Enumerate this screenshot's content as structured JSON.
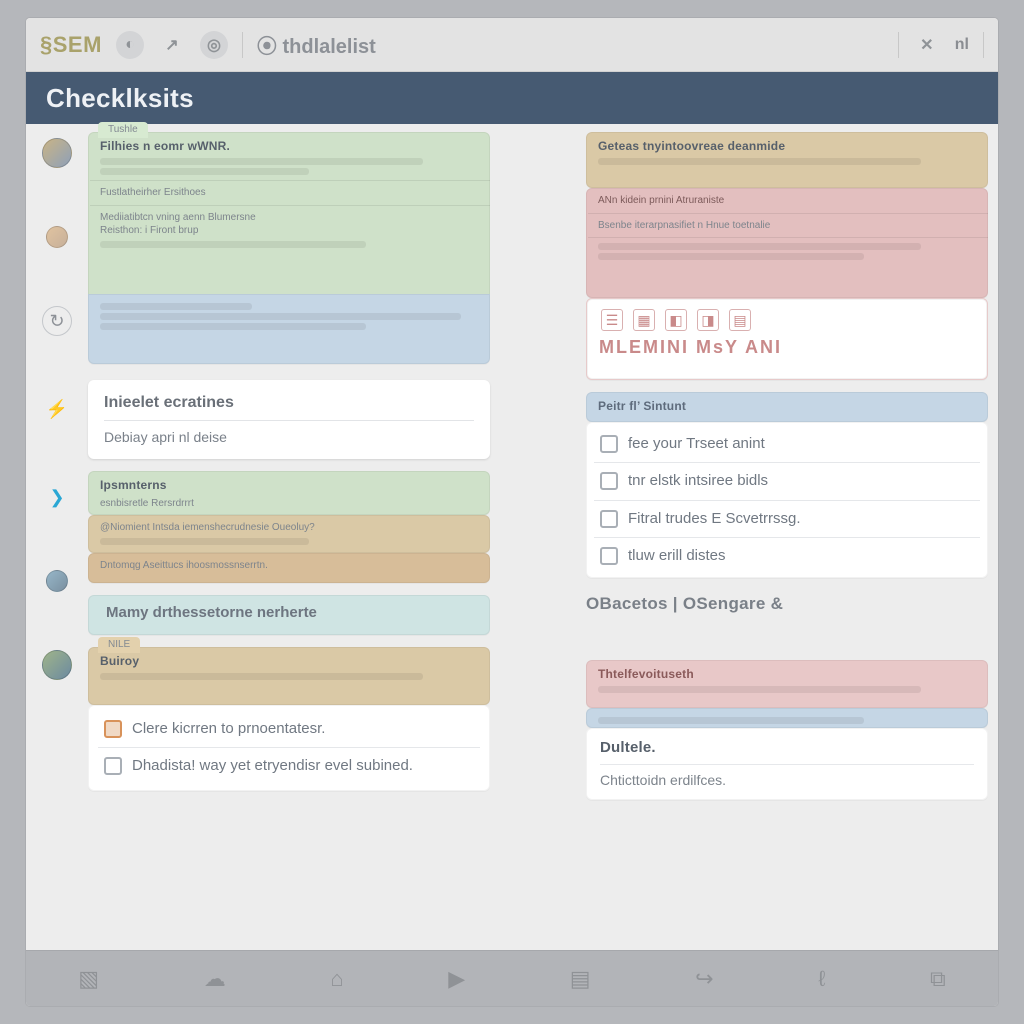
{
  "toolbar": {
    "logo": "§SEM",
    "title": "⦿ thdlalelist",
    "right_label": "nl"
  },
  "header": {
    "title": "Checklksits"
  },
  "sections": {
    "label": "OBacetos | OSengare &"
  },
  "left": {
    "card1": {
      "tab": "Tushle",
      "title": "Filhies n eomr wWNR.",
      "line2": "Fustlatheirher Ersithoes",
      "line3": "Mediiatibtcn vning aenn Blumersne",
      "line4": "Reisthon: i Firont brup"
    },
    "panel": {
      "title": "Inieelet ecratines",
      "sub": "Debiay apri nl deise"
    },
    "card3a": {
      "title": "Ipsmnterns",
      "line1": "esnbisretle Rersrdrrrt"
    },
    "card3b": {
      "line1": "@Niomient Intsda iemenshecrudnesie Oueoluy?"
    },
    "card3c": {
      "line1": "Dntomqg Aseittucs ihoosmossnserrtn."
    },
    "title4": "Mamy drthessetorne nerherte",
    "card5": {
      "tab": "NILE",
      "title": "Buiroy"
    },
    "check5": {
      "a": "Clere kicrren to prnoentatesr.",
      "b": "Dhadista! way yet etryendisr evel subined."
    }
  },
  "right": {
    "card1": {
      "title": "Geteas tnyintoovreae deanmide",
      "line1": "ANn kidein prnini Atruraniste",
      "line2": "Bsenbe iterarpnasifiet n Hnue toetnalie"
    },
    "rowA": {
      "letters": "MLEMINI   MsY   ANI"
    },
    "panel": {
      "header": "Peitr fl’ Sintunt",
      "items": [
        "fee your Trseet anint",
        "tnr elstk intsiree bidls",
        "Fitral trudes E Scvetrrssg.",
        "tluw erill distes"
      ]
    },
    "card3": {
      "title": "Thtelfevoituseth"
    },
    "card4": {
      "title": "Dultele.",
      "sub": "Chticttoidn erdilfces."
    }
  }
}
